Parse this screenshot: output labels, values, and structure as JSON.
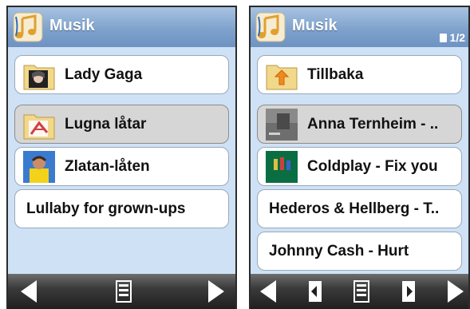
{
  "left_screen": {
    "title": "Musik",
    "items": [
      {
        "label": "Lady Gaga",
        "icon": "folder-photo-icon",
        "selected": false
      },
      {
        "label": "Lugna låtar",
        "icon": "folder-beach-chair-icon",
        "selected": true
      },
      {
        "label": "Zlatan-låten",
        "icon": "photo-icon",
        "selected": false
      },
      {
        "label": "Lullaby for grown-ups",
        "selected": false
      }
    ],
    "footer": [
      "prev-arrow-icon",
      "menu-icon",
      "next-arrow-icon"
    ]
  },
  "right_screen": {
    "title": "Musik",
    "page_indicator": "1/2",
    "items": [
      {
        "label": "Tillbaka",
        "icon": "folder-back-arrow-icon",
        "selected": false
      },
      {
        "label": "Anna Ternheim - ..",
        "icon": "album-cover-icon",
        "selected": true
      },
      {
        "label": "Coldplay - Fix you",
        "icon": "album-cover-icon",
        "selected": false
      },
      {
        "label": "Hederos & Hellberg - T..",
        "selected": false
      },
      {
        "label": "Johnny Cash - Hurt",
        "selected": false
      }
    ],
    "footer": [
      "prev-arrow-icon",
      "page-back-icon",
      "menu-icon",
      "page-forward-icon",
      "next-arrow-icon"
    ]
  },
  "colors": {
    "header": "#7fa2cc",
    "background": "#cfe1f5",
    "selected_item": "#d6d6d6",
    "footer": "#2e2e2e"
  }
}
